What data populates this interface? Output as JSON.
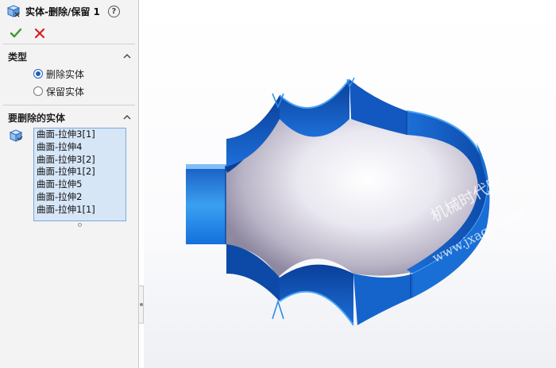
{
  "panel": {
    "title": "实体-删除/保留 1",
    "help_symbol": "?",
    "type_section": {
      "title": "类型",
      "options": [
        {
          "label": "删除实体",
          "selected": true
        },
        {
          "label": "保留实体",
          "selected": false
        }
      ]
    },
    "bodies_section": {
      "title": "要删除的实体",
      "items": [
        "曲面-拉伸3[1]",
        "曲面-拉伸4",
        "曲面-拉伸3[2]",
        "曲面-拉伸1[2]",
        "曲面-拉伸5",
        "曲面-拉伸2",
        "曲面-拉伸1[1]"
      ]
    }
  },
  "watermark": {
    "line1": "机械时代网",
    "line2": "www.jxage.com"
  },
  "colors": {
    "accent_blue": "#1f5fbf",
    "ok_green": "#3a9a2a",
    "cancel_red": "#d42020",
    "surface_blue": "#1565d0",
    "list_bg": "#d6e6f7"
  },
  "icons": {
    "feature": "delete-keep-body-icon",
    "ok": "checkmark-icon",
    "cancel": "close-icon",
    "help": "help-icon",
    "collapse": "chevron-up-icon",
    "bodies": "solid-body-icon"
  }
}
